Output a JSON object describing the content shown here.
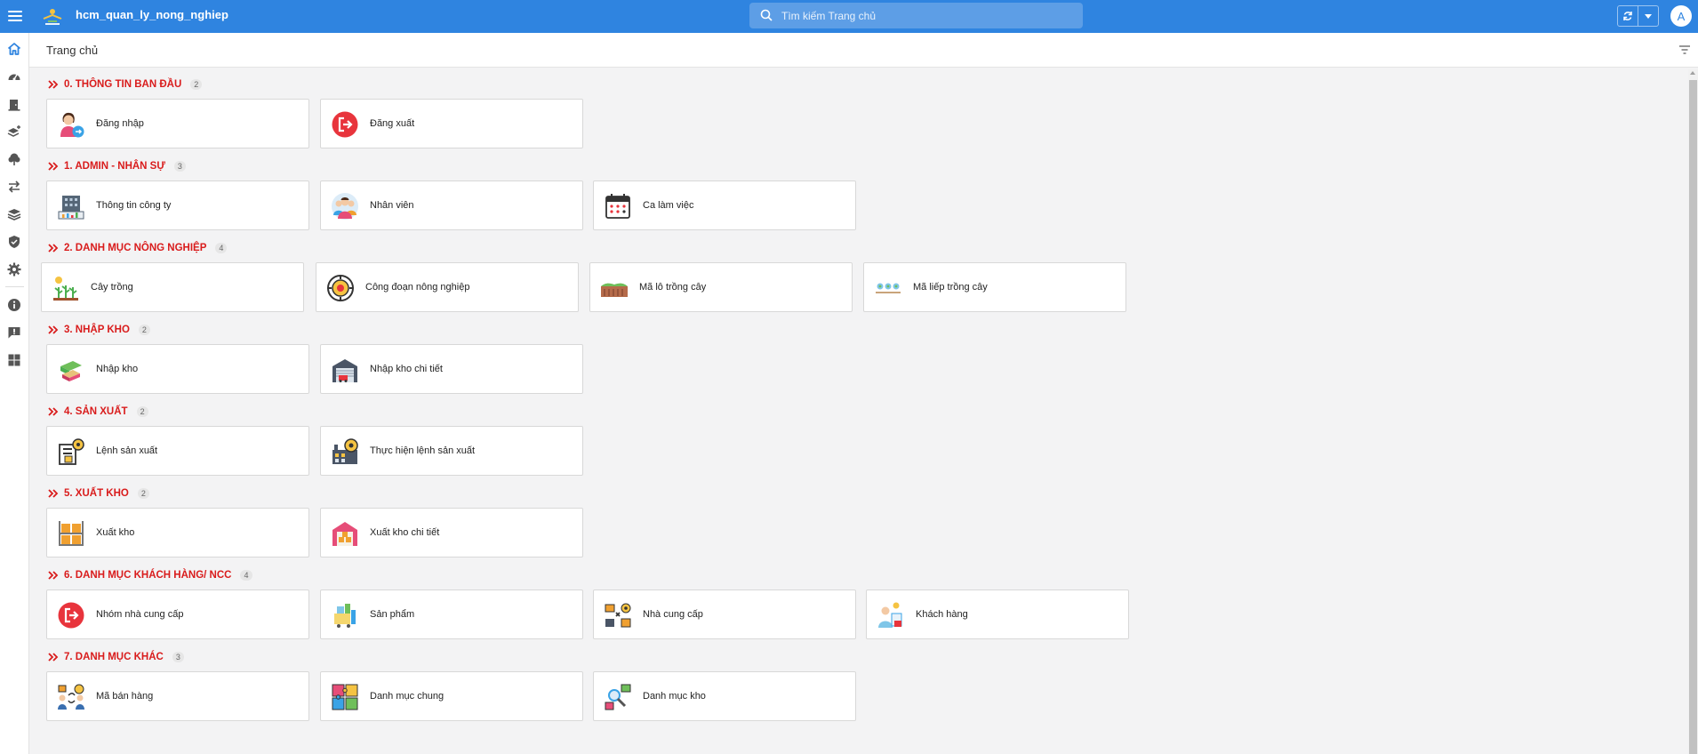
{
  "app": {
    "title": "hcm_quan_ly_nong_nghiep",
    "avatar_letter": "A"
  },
  "search": {
    "placeholder": "Tìm kiếm Trang chủ"
  },
  "page": {
    "title": "Trang chủ"
  },
  "sidebar": {
    "items": [
      "home-icon",
      "dashboard-icon",
      "door-icon",
      "layers-plus-icon",
      "tree-icon",
      "transfer-icon",
      "stack-icon",
      "shield-icon",
      "gear-icon",
      "info-icon",
      "feedback-icon",
      "apps-icon"
    ]
  },
  "colors": {
    "topbar": "#2f84e0",
    "section_title": "#d91c1c",
    "background": "#f3f3f4"
  },
  "sections": [
    {
      "title": "0. THÔNG TIN BAN ĐẦU",
      "count": "2",
      "cards": [
        {
          "label": "Đăng nhập",
          "icon": "user-login-icon"
        },
        {
          "label": "Đăng xuất",
          "icon": "logout-icon"
        }
      ]
    },
    {
      "title": "1. ADMIN - NHÂN SỰ",
      "count": "3",
      "cards": [
        {
          "label": "Thông tin công ty",
          "icon": "company-building-icon"
        },
        {
          "label": "Nhân viên",
          "icon": "employee-icon"
        },
        {
          "label": "Ca làm việc",
          "icon": "calendar-icon"
        }
      ]
    },
    {
      "title": "2. DANH MỤC NÔNG NGHIỆP",
      "count": "4",
      "cards": [
        {
          "label": "Cây trồng",
          "icon": "plant-icon"
        },
        {
          "label": "Công đoạn nông nghiệp",
          "icon": "process-gear-icon"
        },
        {
          "label": "Mã lô trồng cây",
          "icon": "plot-icon"
        },
        {
          "label": "Mã liếp trồng cây",
          "icon": "bed-row-icon"
        }
      ]
    },
    {
      "title": "3. NHẬP KHO",
      "count": "2",
      "cards": [
        {
          "label": "Nhập kho",
          "icon": "books-icon"
        },
        {
          "label": "Nhập kho chi tiết",
          "icon": "warehouse-truck-icon"
        }
      ]
    },
    {
      "title": "4. SẢN XUẤT",
      "count": "2",
      "cards": [
        {
          "label": "Lệnh sản xuất",
          "icon": "production-order-icon"
        },
        {
          "label": "Thực hiện lệnh sản xuất",
          "icon": "factory-icon"
        }
      ]
    },
    {
      "title": "5. XUẤT KHO",
      "count": "2",
      "cards": [
        {
          "label": "Xuất kho",
          "icon": "shelves-icon"
        },
        {
          "label": "Xuất kho chi tiết",
          "icon": "warehouse-icon"
        }
      ]
    },
    {
      "title": "6. DANH MỤC KHÁCH HÀNG/ NCC",
      "count": "4",
      "cards": [
        {
          "label": "Nhóm nhà cung cấp",
          "icon": "logout-icon"
        },
        {
          "label": "Sản phẩm",
          "icon": "product-icon"
        },
        {
          "label": "Nhà cung cấp",
          "icon": "supplier-icon"
        },
        {
          "label": "Khách hàng",
          "icon": "customer-icon"
        }
      ]
    },
    {
      "title": "7. DANH MỤC KHÁC",
      "count": "3",
      "cards": [
        {
          "label": "Mã bán hàng",
          "icon": "sales-code-icon"
        },
        {
          "label": "Danh mục chung",
          "icon": "puzzle-icon"
        },
        {
          "label": "Danh mục kho",
          "icon": "search-inventory-icon"
        }
      ]
    }
  ]
}
